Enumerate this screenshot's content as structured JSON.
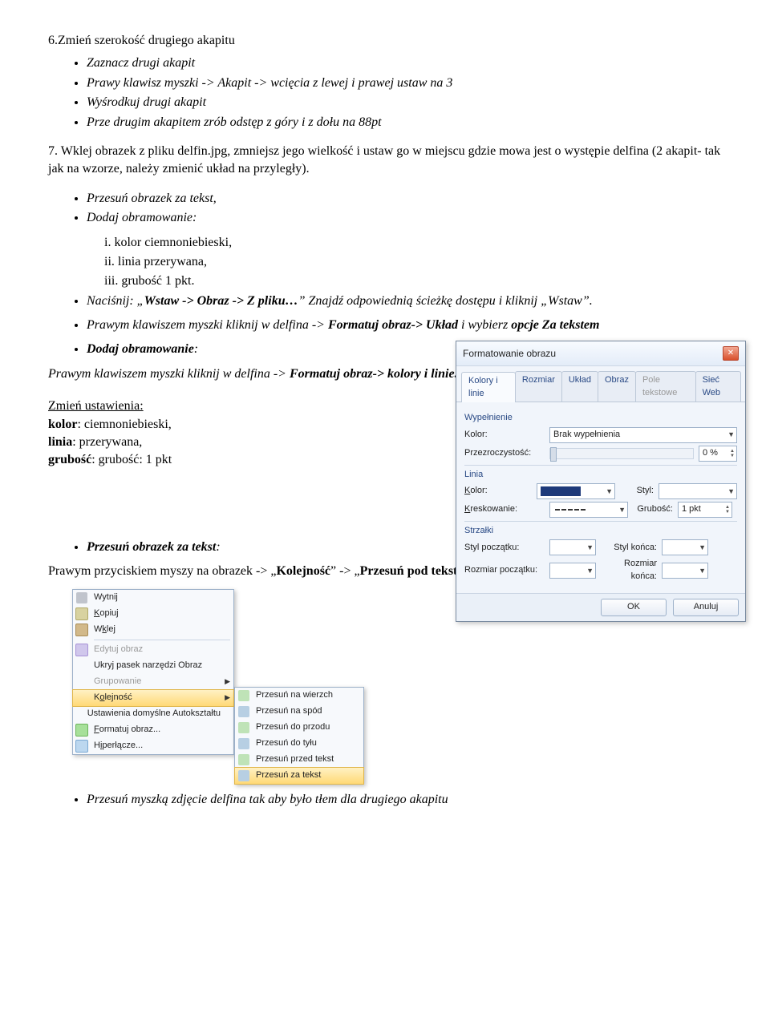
{
  "title": "6.Zmień szerokość  drugiego akapitu",
  "step1": {
    "b1": "Zaznacz drugi akapit",
    "b2": "Prawy klawisz myszki -> Akapit -> wcięcia z lewej i prawej ustaw na 3",
    "b3": "Wyśrodkuj drugi akapit",
    "b4": "Prze drugim akapitem zrób odstęp z góry i z dołu na 88pt"
  },
  "p7": "7. Wklej obrazek z pliku delfin.jpg, zmniejsz jego wielkość i ustaw go w miejscu gdzie mowa jest o występie delfina (2 akapit- tak jak na wzorze, należy zmienić układ na przyległy).",
  "step2": {
    "b1": "Przesuń obrazek za tekst,",
    "b2": "Dodaj obramowanie:",
    "r1": "i.    kolor ciemnoniebieski,",
    "r2": "ii.   linia przerywana,",
    "r3": "iii.  grubość 1 pkt."
  },
  "nacisnij": {
    "pre": "Naciśnij: „",
    "path": "Wstaw -> Obraz -> Z pliku…",
    "mid": "” Znajdź odpowiednią ścieżkę dostępu i kliknij „",
    "end": "Wstaw”."
  },
  "prawym1": {
    "pre": "Prawym klawiszem myszki kliknij w delfina -> ",
    "b1": "Formatuj obraz-> Układ",
    "mid": " i wybierz ",
    "b2": "opcje",
    "sp": "  ",
    "b3": "Za tekstem"
  },
  "dodaj": {
    "hdr": "Dodaj obramowanie",
    "line": "Prawym klawiszem myszki kliknij w delfina -> ",
    "b1": "Formatuj obraz->  kolory i linie."
  },
  "zmien": {
    "hdr": "Zmień ustawienia:",
    "l1a": "kolor",
    "l1b": ": ciemnoniebieski,",
    "l2a": "linia",
    "l2b": ": przerywana,",
    "l3a": "grubość",
    "l3b": ": grubość: 1 pkt"
  },
  "przesun": {
    "hdr": "Przesuń obrazek za tekst",
    "line_pre": "Prawym przyciskiem myszy na obrazek -> „",
    "b1": "Kolejność",
    "mid": "” -> „",
    "b2": "Przesuń pod tekst",
    "end": "”"
  },
  "last": "Przesuń myszką zdjęcie delfina tak aby było tłem dla drugiego akapitu",
  "dialog": {
    "title": "Formatowanie obrazu",
    "tabs": [
      "Kolory i linie",
      "Rozmiar",
      "Układ",
      "Obraz",
      "Pole tekstowe",
      "Sieć Web"
    ],
    "grp_fill": "Wypełnienie",
    "lbl_color": "Kolor:",
    "fill_val": "Brak wypełnienia",
    "lbl_trans": "Przezroczystość:",
    "trans_val": "0 %",
    "grp_line": "Linia",
    "lbl_kolor": "Kolor:",
    "lbl_styl": "Styl:",
    "lbl_kresk": "Kreskowanie:",
    "lbl_grub": "Grubość:",
    "grub_val": "1 pkt",
    "grp_arrow": "Strzałki",
    "lbl_sp": "Styl początku:",
    "lbl_sk": "Styl końca:",
    "lbl_rp": "Rozmiar początku:",
    "lbl_rk": "Rozmiar końca:",
    "btn_ok": "OK",
    "btn_cancel": "Anuluj"
  },
  "ctx1": {
    "wytnij": "Wytnij",
    "kopiuj": "Kopiuj",
    "wklej": "Wklej",
    "edytuj": "Edytuj obraz",
    "ukryj": "Ukryj pasek narzędzi Obraz",
    "grup": "Grupowanie",
    "kolej": "Kolejność",
    "usta": "Ustawienia domyślne Autokształtu",
    "format": "Formatuj obraz...",
    "hiper": "Hiperłącze..."
  },
  "ctx2": {
    "i1": "Przesuń na wierzch",
    "i2": "Przesuń na spód",
    "i3": "Przesuń do przodu",
    "i4": "Przesuń do tyłu",
    "i5": "Przesuń przed tekst",
    "i6": "Przesuń za tekst"
  }
}
